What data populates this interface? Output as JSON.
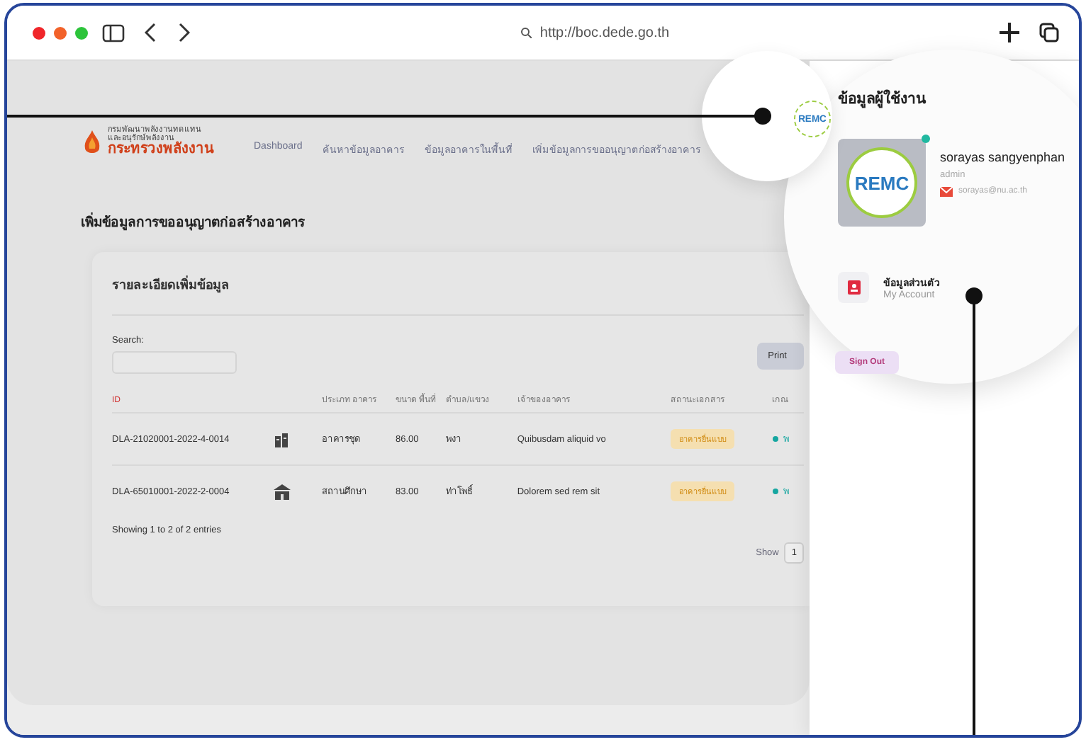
{
  "browser": {
    "url": "http://boc.dede.go.th"
  },
  "header": {
    "logo_lines": [
      "กรมพัฒนาพลังงานทดแทน",
      "และอนุรักษ์พลังงาน"
    ],
    "logo_name": "กระทรวงพลังงาน",
    "nav": [
      {
        "label": "Dashboard",
        "selected": false
      },
      {
        "label": "ค้นหาข้อมูลอาคาร",
        "selected": false
      },
      {
        "label": "ข้อมูลอาคารในพื้นที่",
        "selected": false
      },
      {
        "label": "เพิ่มข้อมูลการขออนุญาตก่อสร้างอาคาร",
        "selected": false
      }
    ],
    "avatar_text": "REMC"
  },
  "page_title": "เพิ่มข้อมูลการขออนุญาตก่อสร้างอาคาร",
  "card": {
    "title": "รายละเอียดเพิ่มข้อมูล",
    "search_label": "Search:",
    "print_button": "Print",
    "columns": [
      "ID",
      "ประเภท อาคาร",
      "ขนาด พื้นที่",
      "ตำบล/แขวง",
      "เจ้าของอาคาร",
      "สถานะเอกสาร",
      "เกณ"
    ],
    "rows": [
      {
        "id": "DLA-21020001-2022-4-0014",
        "kind": "apartment",
        "type": "อาคารชุด",
        "area": "86.00",
        "district": "พงา",
        "owner": "Quibusdam aliquid vo",
        "status": "อาคารยื่นแบบ",
        "column_8": "พ"
      },
      {
        "id": "DLA-65010001-2022-2-0004",
        "kind": "school",
        "type": "สถานศึกษา",
        "area": "83.00",
        "district": "ท่าโพธิ์",
        "owner": "Dolorem sed rem sit",
        "status": "อาคารยื่นแบบ",
        "column_8": "พ"
      }
    ],
    "info": "Showing 1 to 2 of 2 entries",
    "show_label": "Show",
    "page_length": "1"
  },
  "user_panel": {
    "title": "ข้อมูลผู้ใช้งาน",
    "avatar_text": "REMC",
    "online": true,
    "name": "sorayas sangyenphan",
    "role": "admin",
    "email": "sorayas@nu.ac.th",
    "menu": [
      {
        "title": "ข้อมูลส่วนตัว",
        "subtitle": "My Account"
      }
    ],
    "sign_out": "Sign Out"
  }
}
